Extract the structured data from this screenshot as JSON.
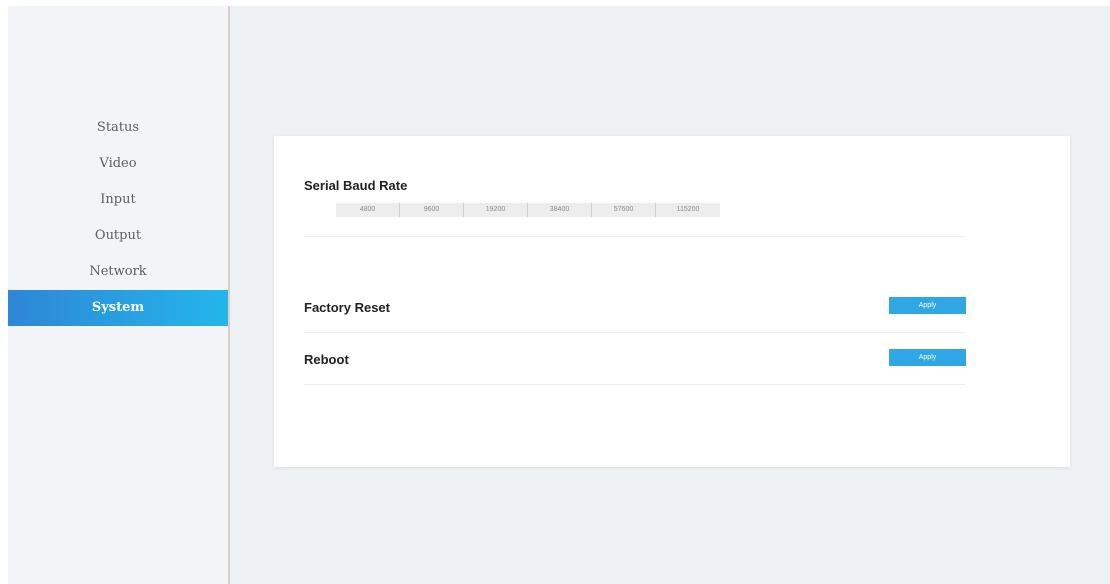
{
  "sidebar": {
    "items": [
      {
        "label": "Status",
        "active": false
      },
      {
        "label": "Video",
        "active": false
      },
      {
        "label": "Input",
        "active": false
      },
      {
        "label": "Output",
        "active": false
      },
      {
        "label": "Network",
        "active": false
      },
      {
        "label": "System",
        "active": true
      }
    ]
  },
  "main": {
    "serial_baud_rate": {
      "title": "Serial Baud Rate",
      "options": [
        "4800",
        "9600",
        "19200",
        "38400",
        "57600",
        "115200"
      ]
    },
    "factory_reset": {
      "title": "Factory Reset",
      "button_label": "Apply"
    },
    "reboot": {
      "title": "Reboot",
      "button_label": "Apply"
    }
  },
  "colors": {
    "accent": "#2fa7e4",
    "active_nav_start": "#2e86d6",
    "active_nav_end": "#23b6ea",
    "main_bg": "#eef1f4"
  }
}
